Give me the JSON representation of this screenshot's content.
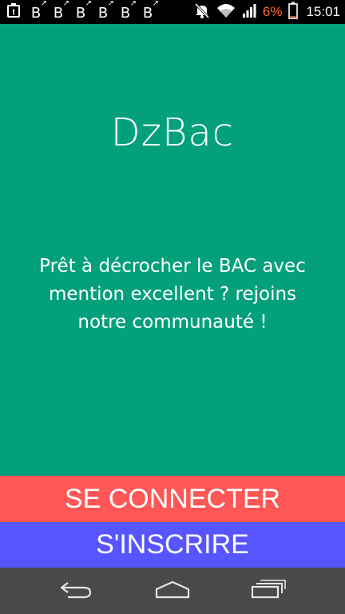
{
  "status_bar": {
    "left_icons": [
      "warning-icon",
      "b-notification-icon",
      "b-notification-icon",
      "b-notification-icon",
      "b-notification-icon",
      "b-notification-icon",
      "b-notification-icon"
    ],
    "notification_letter": "B",
    "right_icons": [
      "mute-icon",
      "wifi-icon",
      "signal-icon",
      "battery-icon"
    ],
    "battery_percent": "6%",
    "battery_level": 0.06,
    "time": "15:01",
    "battery_color": "#ff6d2e"
  },
  "main": {
    "title": "DzBac",
    "tagline": "Prêt à décrocher le BAC avec mention excellent ? rejoins notre communauté !",
    "background_color": "#04a07c"
  },
  "buttons": {
    "login_label": "SE CONNECTER",
    "login_color": "#ff5656",
    "signup_label": "S'INSCRIRE",
    "signup_color": "#5755ff"
  },
  "nav_bar": {
    "icons": [
      "back-icon",
      "home-icon",
      "recent-apps-icon"
    ]
  }
}
